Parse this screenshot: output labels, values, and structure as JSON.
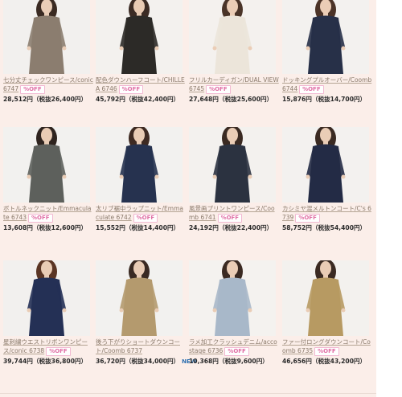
{
  "products": [
    {
      "name_prefix": "七分丈チェックワンピース/conic",
      "item_no": "6747",
      "price": "28,512円（税抜26,400円）",
      "badge": "%OFF",
      "is_new": false,
      "colors": {
        "bg": "#f2f0ee",
        "garment": "#8b7d6f",
        "hair": "#3a2a22",
        "skin": "#e9cdb7"
      }
    },
    {
      "name_prefix": "配色ダウンハーフコート/CHILLEA",
      "item_no": "6746",
      "price": "45,792円（税抜42,400円）",
      "badge": "%OFF",
      "is_new": false,
      "colors": {
        "bg": "#f3f1ee",
        "garment": "#2c2a27",
        "hair": "#3b2b24",
        "skin": "#e8cbb4"
      }
    },
    {
      "name_prefix": "フリルカーディガン/DUAL VIEW",
      "item_no": "6745",
      "price": "27,648円（税抜25,600円）",
      "badge": "%OFF",
      "is_new": false,
      "colors": {
        "bg": "#f4f1ee",
        "garment": "#ece5da",
        "hair": "#4a3428",
        "skin": "#ebcdb6"
      }
    },
    {
      "name_prefix": "ドッキングプルオーバー/Coomb",
      "item_no": "6744",
      "price": "15,876円（税抜14,700円）",
      "badge": "%OFF",
      "is_new": false,
      "colors": {
        "bg": "#f3f1ef",
        "garment": "#273048",
        "hair": "#4b3327",
        "skin": "#ebcdb6"
      }
    },
    {
      "name_prefix": "ボトルネックニット/Emmaculate",
      "item_no": "6743",
      "price": "13,608円（税抜12,600円）",
      "badge": "%OFF",
      "is_new": false,
      "colors": {
        "bg": "#f2f1ef",
        "garment": "#5d605c",
        "hair": "#2f241f",
        "skin": "#e9ccb5"
      }
    },
    {
      "name_prefix": "太リブ裾中ラップニット/Emmaculate",
      "item_no": "6742",
      "price": "15,552円（税抜14,400円）",
      "badge": "%OFF",
      "is_new": false,
      "colors": {
        "bg": "#f2f1ef",
        "garment": "#26324f",
        "hair": "#3e2a22",
        "skin": "#e9ccb5"
      }
    },
    {
      "name_prefix": "風景画プリントワンピース/Coomb",
      "item_no": "6741",
      "price": "24,192円（税抜22,400円）",
      "badge": "%OFF",
      "is_new": false,
      "colors": {
        "bg": "#f3f1ee",
        "garment": "#2b3240",
        "hair": "#3a2a22",
        "skin": "#eacdb6"
      }
    },
    {
      "name_prefix": "カシミヤ混メルトンコート/C's",
      "item_no": "6739",
      "price": "58,752円（税抜54,400円）",
      "badge": "%OFF",
      "is_new": false,
      "colors": {
        "bg": "#f3f1ef",
        "garment": "#232b45",
        "hair": "#3a2a22",
        "skin": "#eacdb6"
      }
    },
    {
      "name_prefix": "星刺繍ウエストリボンワンピース/conic",
      "item_no": "6738",
      "price": "39,744円（税抜36,800円）",
      "badge": "%OFF",
      "is_new": false,
      "colors": {
        "bg": "#f2f0ee",
        "garment": "#243055",
        "hair": "#5a3524",
        "skin": "#e9ccb5"
      }
    },
    {
      "name_prefix": "後ろ下がりショートダウンコート/Coomb",
      "item_no": "6737",
      "price": "36,720円（税抜34,000円）",
      "badge": "",
      "is_new": true,
      "new_label": "NEW",
      "colors": {
        "bg": "#f2f1ef",
        "garment": "#b49a6e",
        "hair": "#3a2a22",
        "skin": "#e9ccb5"
      }
    },
    {
      "name_prefix": "ラメ加工クラッシュデニム/accostage",
      "item_no": "6736",
      "price": "10,368円（税抜9,600円）",
      "badge": "%OFF",
      "is_new": false,
      "colors": {
        "bg": "#f4f2ef",
        "garment": "#a8b8c9",
        "hair": "#3a2a22",
        "skin": "#eacdb6"
      }
    },
    {
      "name_prefix": "ファー付ロングダウンコート/Coomb",
      "item_no": "6735",
      "price": "46,656円（税抜43,200円）",
      "badge": "%OFF",
      "is_new": false,
      "colors": {
        "bg": "#f3f1ee",
        "garment": "#b79a62",
        "hair": "#3a2a22",
        "skin": "#e9ccb5"
      }
    }
  ]
}
